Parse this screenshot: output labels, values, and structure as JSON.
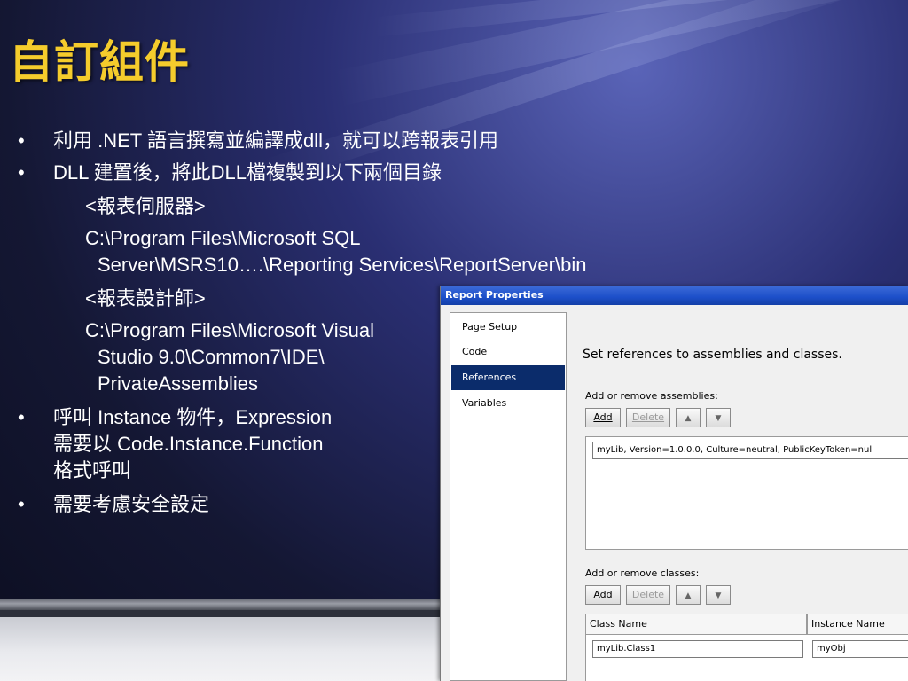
{
  "slide": {
    "title": "自訂組件",
    "bullets": [
      "利用 .NET 語言撰寫並編譯成dll，就可以跨報表引用",
      "DLL 建置後，將此DLL檔複製到以下兩個目錄",
      "<報表伺服器>",
      "C:\\Program Files\\Microsoft SQL",
      "Server\\MSRS10….\\Reporting Services\\ReportServer\\bin",
      "<報表設計師>",
      "C:\\Program Files\\Microsoft Visual",
      "Studio 9.0\\Common7\\IDE\\",
      "PrivateAssemblies",
      "呼叫 Instance 物件，Expression",
      "需要以 Code.Instance.Function",
      "格式呼叫",
      "需要考慮安全設定"
    ],
    "bullet_glyph": "•"
  },
  "dialog": {
    "title": "Report Properties",
    "nav": [
      "Page Setup",
      "Code",
      "References",
      "Variables"
    ],
    "active_nav": "References",
    "heading": "Set references to assemblies and classes.",
    "assemblies": {
      "label": "Add or remove assemblies:",
      "add": "Add",
      "delete": "Delete",
      "value": "myLib, Version=1.0.0.0, Culture=neutral, PublicKeyToken=null"
    },
    "classes": {
      "label": "Add or remove classes:",
      "add": "Add",
      "delete": "Delete",
      "columns": [
        "Class Name",
        "Instance Name"
      ],
      "row": [
        "myLib.Class1",
        "myObj"
      ]
    },
    "up_arrow": "▲",
    "down_arrow": "▼"
  },
  "colors": {
    "title": "#f5cc2c",
    "active_nav": "#0b2c6b",
    "titlebar": "#1c4fc9"
  }
}
